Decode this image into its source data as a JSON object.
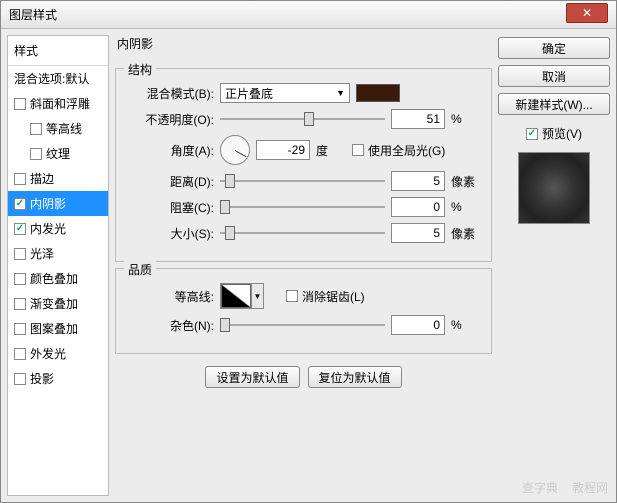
{
  "window": {
    "title": "图层样式"
  },
  "left": {
    "header": "样式",
    "blending": "混合选项:默认",
    "items": [
      {
        "label": "斜面和浮雕",
        "checked": false,
        "indent": false
      },
      {
        "label": "等高线",
        "checked": false,
        "indent": true
      },
      {
        "label": "纹理",
        "checked": false,
        "indent": true
      },
      {
        "label": "描边",
        "checked": false,
        "indent": false
      },
      {
        "label": "内阴影",
        "checked": true,
        "indent": false,
        "selected": true
      },
      {
        "label": "内发光",
        "checked": true,
        "indent": false
      },
      {
        "label": "光泽",
        "checked": false,
        "indent": false
      },
      {
        "label": "颜色叠加",
        "checked": false,
        "indent": false
      },
      {
        "label": "渐变叠加",
        "checked": false,
        "indent": false
      },
      {
        "label": "图案叠加",
        "checked": false,
        "indent": false
      },
      {
        "label": "外发光",
        "checked": false,
        "indent": false
      },
      {
        "label": "投影",
        "checked": false,
        "indent": false
      }
    ]
  },
  "center": {
    "title": "内阴影",
    "structure": {
      "legend": "结构",
      "blend_label": "混合模式(B):",
      "blend_value": "正片叠底",
      "swatch_color": "#3a1a0a",
      "opacity_label": "不透明度(O):",
      "opacity_value": "51",
      "opacity_unit": "%",
      "angle_label": "角度(A):",
      "angle_value": "-29",
      "angle_unit": "度",
      "global_light_label": "使用全局光(G)",
      "global_light_checked": false,
      "distance_label": "距离(D):",
      "distance_value": "5",
      "distance_unit": "像素",
      "choke_label": "阻塞(C):",
      "choke_value": "0",
      "choke_unit": "%",
      "size_label": "大小(S):",
      "size_value": "5",
      "size_unit": "像素"
    },
    "quality": {
      "legend": "品质",
      "contour_label": "等高线:",
      "antialias_label": "消除锯齿(L)",
      "antialias_checked": false,
      "noise_label": "杂色(N):",
      "noise_value": "0",
      "noise_unit": "%"
    },
    "buttons": {
      "make_default": "设置为默认值",
      "reset_default": "复位为默认值"
    }
  },
  "right": {
    "ok": "确定",
    "cancel": "取消",
    "new_style": "新建样式(W)...",
    "preview_label": "预览(V)",
    "preview_checked": true
  },
  "watermark": {
    "a": "查字典",
    "b": "教程网"
  }
}
